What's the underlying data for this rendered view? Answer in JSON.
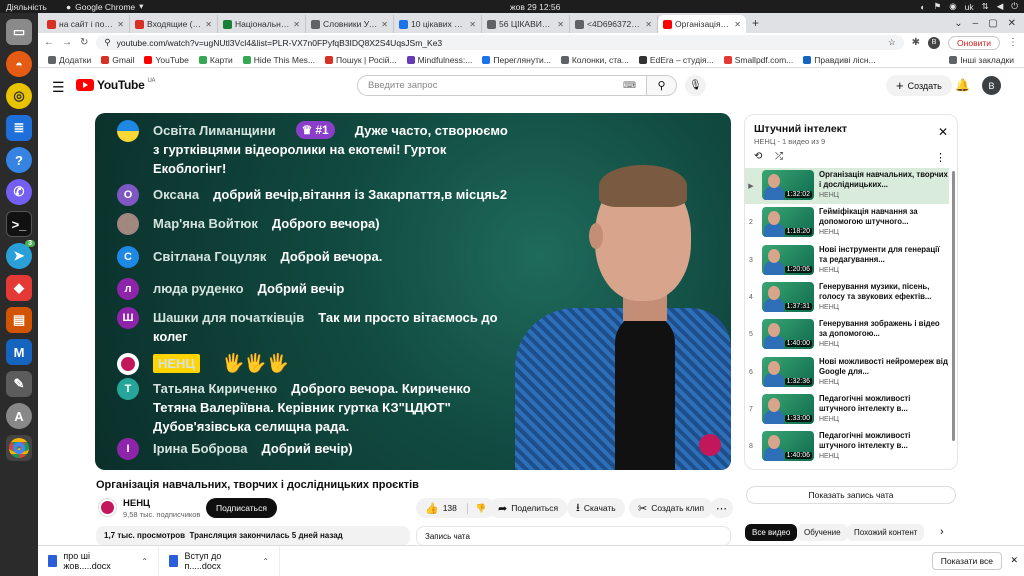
{
  "os": {
    "activities": "Діяльність",
    "app_name": "Google Chrome",
    "clock": "жов 29  12:56",
    "lang": "uk",
    "dock_badge": "3"
  },
  "tabs": [
    {
      "label": "на сайт і посилання",
      "color": "#d93025"
    },
    {
      "label": "Входящие (783) - olg",
      "color": "#d93025"
    },
    {
      "label": "Національний екоі",
      "color": "#188038"
    },
    {
      "label": "Словники України о",
      "color": "#5f6368"
    },
    {
      "label": "10 цікавих фактів, я",
      "color": "#1a73e8"
    },
    {
      "label": "56 ЦІКАВИХ ФАКТІВ",
      "color": "#5f6368"
    },
    {
      "label": "<4D6963726F736F",
      "color": "#5f6368"
    },
    {
      "label": "Організація навч",
      "color": "#ff0000",
      "active": true
    }
  ],
  "address": {
    "url": "youtube.com/watch?v=ugNUtl3Vcl4&list=PLR-VX7n0FPyfqB3IDQ8X2S4UqsJSm_Ke3",
    "update": "Оновити",
    "profile": "B"
  },
  "bookmarks": [
    {
      "label": "Додатки",
      "color": "#5f6368"
    },
    {
      "label": "Gmail",
      "color": "#d93025"
    },
    {
      "label": "YouTube",
      "color": "#ff0000"
    },
    {
      "label": "Карти",
      "color": "#34a853"
    },
    {
      "label": "Hide This Mes...",
      "color": "#34a853"
    },
    {
      "label": "Пошук | Росій...",
      "color": "#d93025"
    },
    {
      "label": "Mindfulness:...",
      "color": "#673ab7"
    },
    {
      "label": "Переглянути...",
      "color": "#1a73e8"
    },
    {
      "label": "Колонки, ста...",
      "color": "#5f6368"
    },
    {
      "label": "EdEra – студія...",
      "color": "#333333"
    },
    {
      "label": "Smallpdf.com...",
      "color": "#e53935"
    },
    {
      "label": "Правдиві лісн...",
      "color": "#1565c0"
    }
  ],
  "bookmarks_other": "Інші закладки",
  "yt": {
    "logo": "YouTube",
    "region": "UA",
    "search_placeholder": "Введите запрос",
    "create": "Создать",
    "avatar": "B"
  },
  "video_chat": [
    {
      "name": "Освіта Лиманщини",
      "badge": "#1",
      "msg": "Дуже часто, створюємо",
      "avatar_color": "#1e88e5",
      "avatar_letter": ""
    },
    {
      "msg": "з гуртківцями відеоролики на екотемі! Гурток"
    },
    {
      "msg": "Екоблогінг!"
    },
    {
      "name": "Оксана",
      "msg": "добрий вечір,вітання із Закарпаття,в місцяь2",
      "avatar_color": "#7e57c2",
      "avatar_letter": "О"
    },
    {
      "name": "Мар'яна Войтюк",
      "msg": "Доброго вечора)",
      "avatar_color": "#a1887f",
      "avatar_letter": ""
    },
    {
      "name": "Світлана Гоцуляк",
      "msg": "Доброй вечора.",
      "avatar_color": "#1e88e5",
      "avatar_letter": "С"
    },
    {
      "name": "люда руденко",
      "msg": "Добрий вечір",
      "avatar_color": "#8e24aa",
      "avatar_letter": "л"
    },
    {
      "name": "Шашки для початківців",
      "msg": "Так ми просто вітаємось до",
      "avatar_color": "#8e24aa",
      "avatar_letter": "Ш"
    },
    {
      "msg": "колег"
    },
    {
      "name": "НЕНЦ",
      "avatar_color": "#ffffff",
      "avatar_letter": ""
    },
    {
      "name": "Татьяна Кириченко",
      "msg": "Доброго вечора. Кириченко",
      "avatar_color": "#26a69a",
      "avatar_letter": "Т"
    },
    {
      "msg": "Тетяна Валеріївна. Керівник гуртка КЗ\"ЦДЮТ\""
    },
    {
      "msg": "Дубов'язівська селищна рада."
    },
    {
      "name": "Ірина Боброва",
      "msg": "Добрий вечір)",
      "avatar_color": "#8e24aa",
      "avatar_letter": "І"
    }
  ],
  "video": {
    "title": "Організація навчальних, творчих і дослідницьких проєктів",
    "channel": "НЕНЦ",
    "subscribers": "9,58 тыс. подписчиков",
    "subscribe": "Подписаться",
    "likes": "138",
    "share": "Поделиться",
    "download": "Скачать",
    "clip": "Создать клип",
    "views": "1,7 тыс. просмотров",
    "stream_info": "Трансляция закончилась 5 дней назад",
    "chat_record": "Запись чата"
  },
  "playlist": {
    "title": "Штучний інтелект",
    "subtitle": "НЕНЦ - 1 видео из 9",
    "items": [
      {
        "idx": "▶",
        "title": "Організація навчальних, творчих і дослідницьких...",
        "channel": "НЕНЦ",
        "duration": "1:32:02",
        "current": true
      },
      {
        "idx": "2",
        "title": "Гейміфікація навчання за допомогою штучного...",
        "channel": "НЕНЦ",
        "duration": "1:18:20"
      },
      {
        "idx": "3",
        "title": "Нові інструменти для генерації та редагування...",
        "channel": "НЕНЦ",
        "duration": "1:20:06"
      },
      {
        "idx": "4",
        "title": "Генерування музики, пісень, голосу та звукових ефектів...",
        "channel": "НЕНЦ",
        "duration": "1:37:31"
      },
      {
        "idx": "5",
        "title": "Генерування зображень і відео за допомогою...",
        "channel": "НЕНЦ",
        "duration": "1:40:00"
      },
      {
        "idx": "6",
        "title": "Нові можливості нейромереж від Google для...",
        "channel": "НЕНЦ",
        "duration": "1:32:36"
      },
      {
        "idx": "7",
        "title": "Педагогічні можливості штучного інтелекту в...",
        "channel": "НЕНЦ",
        "duration": "1:33:00"
      },
      {
        "idx": "8",
        "title": "Педагогічні можливості штучного інтелекту в...",
        "channel": "НЕНЦ",
        "duration": "1:40:06"
      }
    ],
    "show_chat": "Показать запись чата"
  },
  "chips": [
    "Все видео",
    "Обучение",
    "Похожий контент"
  ],
  "downloads": {
    "items": [
      "про ші жов.....docx",
      "Вступ до п.....docx"
    ],
    "show_all": "Показати все"
  }
}
